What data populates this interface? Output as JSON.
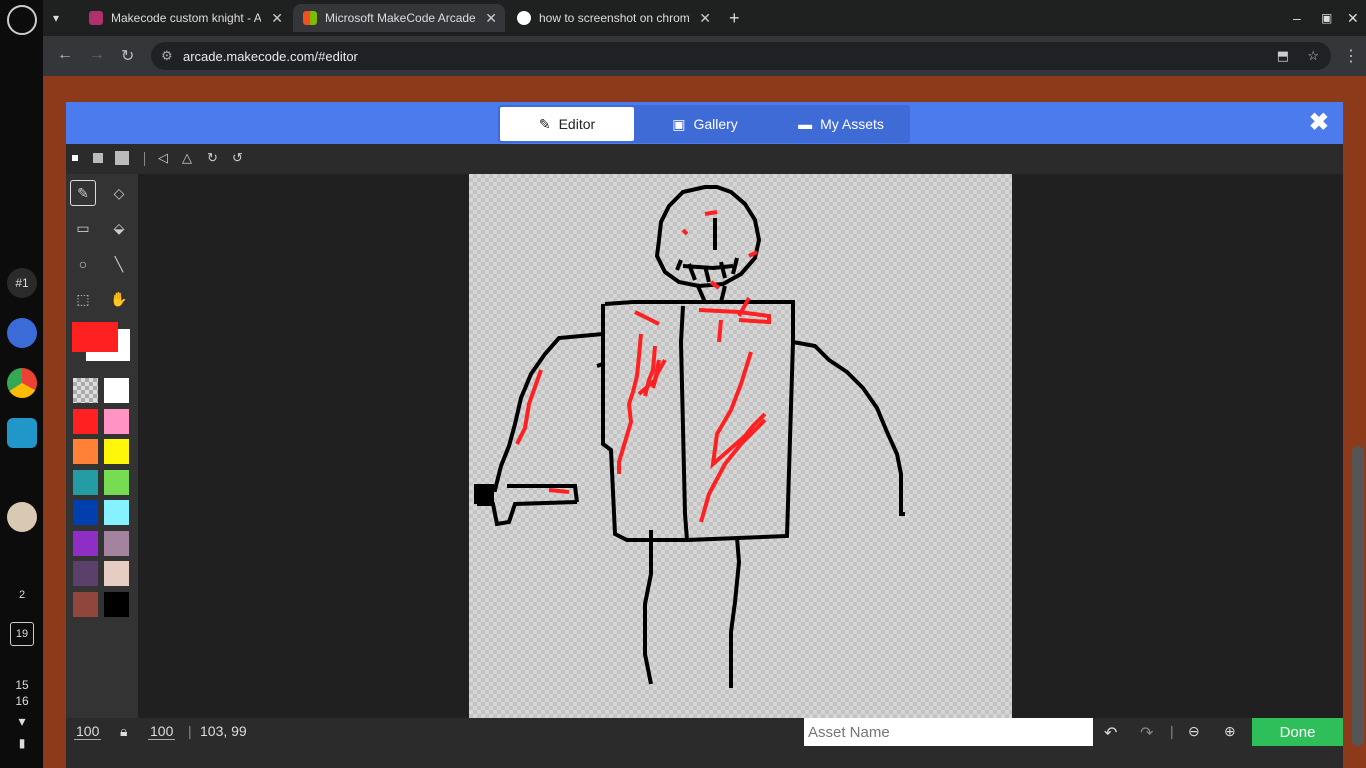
{
  "shelf": {
    "launcher": "○",
    "badge": "#1",
    "calendar_day": "19",
    "files_count": "2",
    "clock_h": "15",
    "clock_m": "16"
  },
  "tabs": [
    {
      "title": "Makecode custom knight - Arca",
      "active": false,
      "favicon_color": "#b0306b"
    },
    {
      "title": "Microsoft MakeCode Arcade",
      "active": true,
      "favicon_color": "#f25022"
    },
    {
      "title": "how to screenshot on chromebo",
      "active": false,
      "favicon_color": "#4285f4"
    }
  ],
  "toolbar": {
    "url": "arcade.makecode.com/#editor"
  },
  "modal": {
    "tabs": [
      "Editor",
      "Gallery",
      "My Assets"
    ],
    "close": "✖"
  },
  "bottom": {
    "width": "100",
    "height": "100",
    "coords": "103, 99",
    "asset_placeholder": "Asset Name",
    "done": "Done"
  },
  "palette": [
    "transparent",
    "#ffffff",
    "#ff2121",
    "#ff93c4",
    "#ff8135",
    "#fff609",
    "#249ca3",
    "#78dc52",
    "#003fad",
    "#87f2ff",
    "#8e2ec4",
    "#a4839f",
    "#5c406c",
    "#e5cdc4",
    "#91463d",
    "#000000"
  ],
  "colors": {
    "foreground": "#ff2121",
    "background": "#ffffff",
    "accent": "#4b7bec",
    "done": "#2fbf5a"
  }
}
